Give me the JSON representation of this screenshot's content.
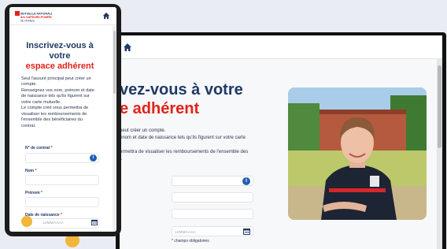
{
  "desktop": {
    "title_line1": "vez-vous à votre",
    "title_line2": "e adhérent",
    "intro_lines": [
      "peut créer un compte.",
      "énom et date de naissance tels qu'ils figurent sur votre carte"
    ],
    "benefit_lines": [
      "ermettra de visualiser les remboursements de l'ensemble des",
      "t."
    ],
    "info_icon_glyph": "i",
    "date_placeholder": "JJ/MM/AAAA",
    "required_note": "* champs obligatoires"
  },
  "mobile": {
    "logo_lines": [
      "MUTUELLE NATIONALE",
      "des SAPEURS-POMPIERS",
      "DE FRANCE"
    ],
    "title_line1": "Inscrivez-vous à",
    "title_line2": "votre",
    "title_line3": "espace adhérent",
    "intro_lines": [
      "Seul l'assuré principal peut créer un",
      "compte.",
      "Renseignez vos nom, prénom et date",
      "de naissance tels qu'ils figurent sur",
      "votre carte mutuelle.",
      "Le compte créé vous permettra de",
      "visualiser les remboursements de",
      "l'ensemble des bénéficiaires du",
      "contrat."
    ],
    "fields": {
      "contract_label": "N° de contrat",
      "name_label": "Nom",
      "firstname_label": "Prénom",
      "birthdate_label": "Date de naissance",
      "required_mark": "*"
    },
    "info_icon_glyph": "i",
    "date_placeholder": "JJ/MM/AAAA"
  },
  "colors": {
    "navy": "#1f3a66",
    "red": "#e2231a",
    "accent_blue": "#1f5fb4",
    "cookie": "#f2b63b"
  },
  "icons": [
    "home-icon",
    "info-icon",
    "calendar-icon",
    "cookie-icon"
  ]
}
